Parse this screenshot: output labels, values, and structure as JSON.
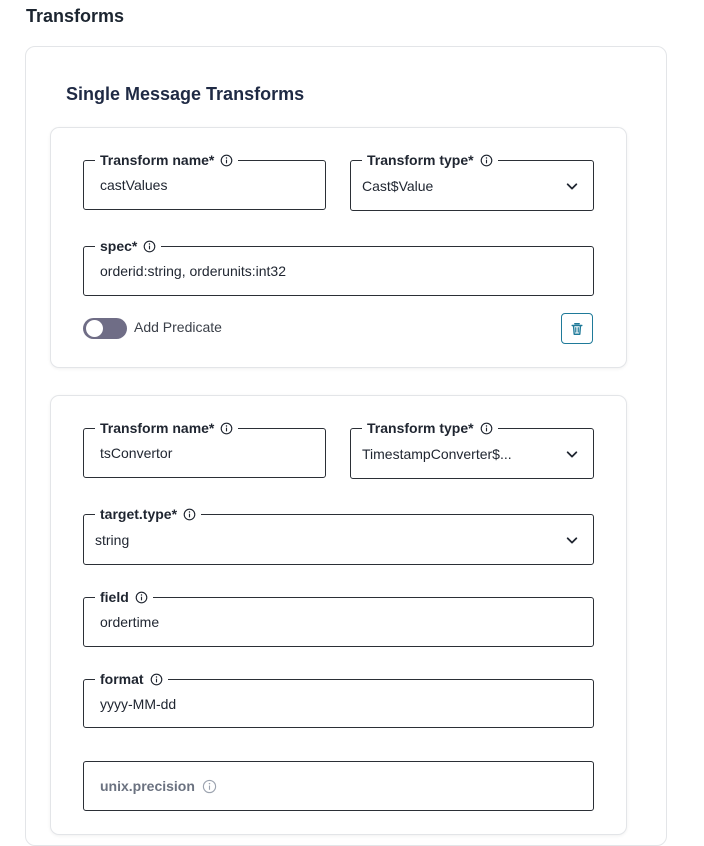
{
  "section": {
    "title": "Transforms"
  },
  "card": {
    "title": "Single Message Transforms"
  },
  "transforms": [
    {
      "name_label": "Transform name*",
      "name_value": "castValues",
      "type_label": "Transform type*",
      "type_value": "Cast$Value",
      "spec_label": "spec*",
      "spec_value": "orderid:string, orderunits:int32",
      "predicate_label": "Add Predicate",
      "predicate_enabled": false
    },
    {
      "name_label": "Transform name*",
      "name_value": "tsConvertor",
      "type_label": "Transform type*",
      "type_value": "TimestampConverter$...",
      "target_type_label": "target.type*",
      "target_type_value": "string",
      "field_label": "field",
      "field_value": "ordertime",
      "format_label": "format",
      "format_value": "yyyy-MM-dd",
      "unix_precision_label": "unix.precision"
    }
  ],
  "colors": {
    "toggle_off": "#6f6d86",
    "delete_accent": "#1f7a99",
    "field_border": "#2b2f36"
  }
}
